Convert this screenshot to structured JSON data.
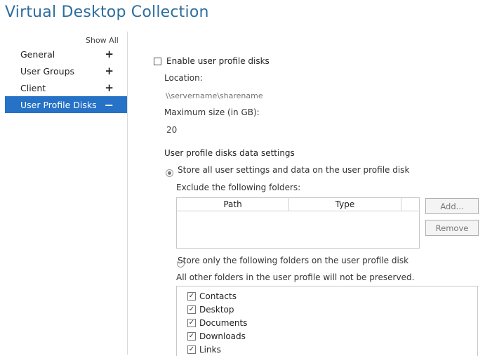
{
  "window": {
    "title": "Virtual Desktop Collection"
  },
  "sidebar": {
    "show_all": "Show All",
    "items": [
      {
        "label": "General",
        "toggle": "+"
      },
      {
        "label": "User Groups",
        "toggle": "+"
      },
      {
        "label": "Client",
        "toggle": "+"
      },
      {
        "label": "User Profile Disks",
        "toggle": "−"
      }
    ]
  },
  "main": {
    "enable_label": "Enable user profile disks",
    "location_label": "Location:",
    "location_placeholder": "\\\\servername\\sharename",
    "max_size_label": "Maximum size (in GB):",
    "max_size_value": "20",
    "settings_heading": "User profile disks data settings",
    "radio_store_all": "Store all user settings and data on the user profile disk",
    "exclude_label": "Exclude the following folders:",
    "table_headers": [
      "Path",
      "Type",
      ""
    ],
    "add_button": "Add...",
    "remove_button": "Remove",
    "radio_store_only": "Store only the following folders on the user profile disk",
    "not_preserved_note": "All other folders in the user profile will not be preserved.",
    "folders": [
      "Contacts",
      "Desktop",
      "Documents",
      "Downloads",
      "Links"
    ],
    "checkmark": "✓"
  },
  "colors": {
    "title": "#2d6e9e",
    "selection": "#2672c7"
  }
}
